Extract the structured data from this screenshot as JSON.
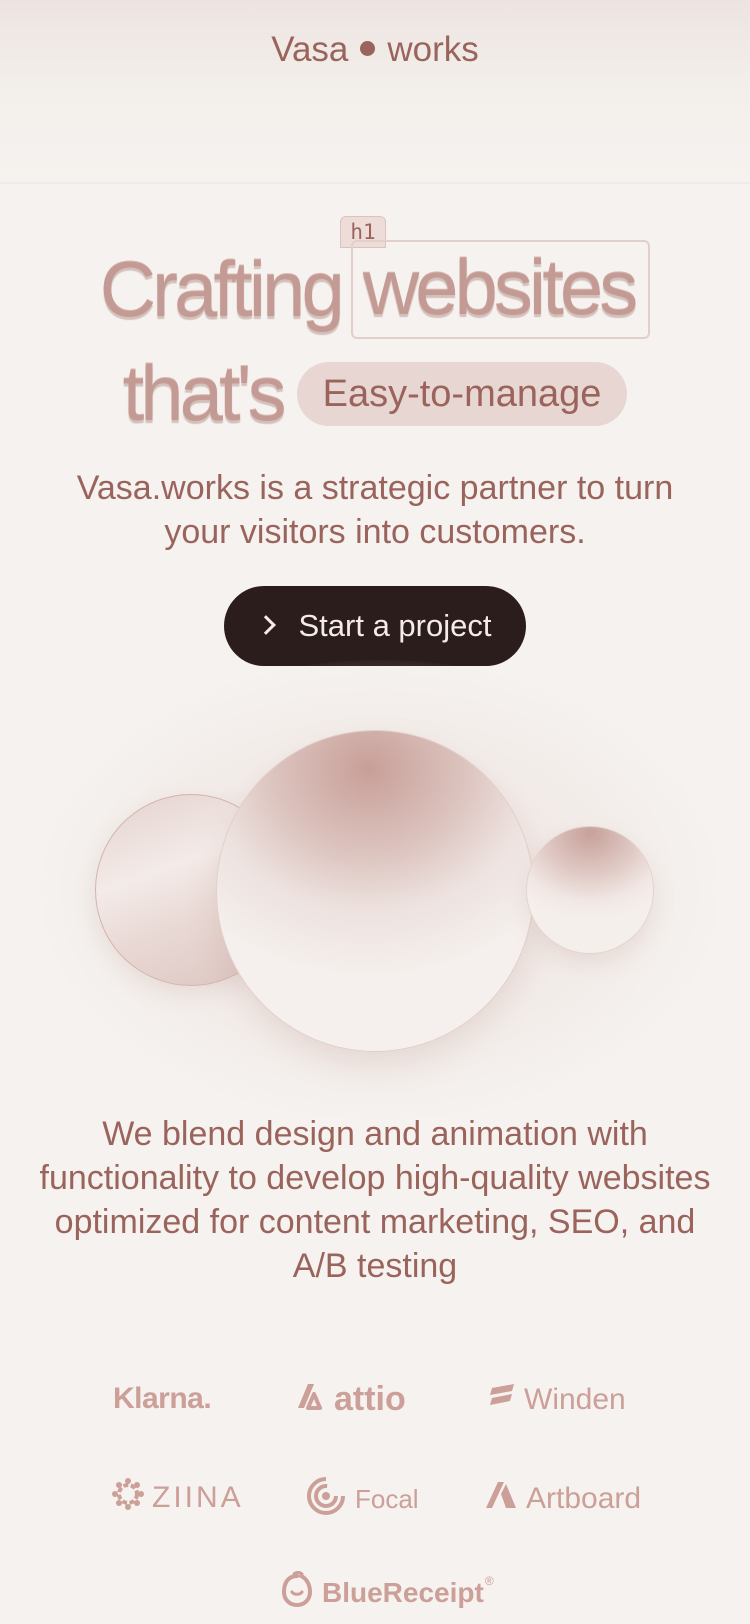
{
  "header": {
    "logo_left": "Vasa",
    "logo_right": "works"
  },
  "hero": {
    "h1_tag": "h1",
    "word_crafting": "Crafting",
    "word_websites": "websites",
    "word_thats": "that's",
    "pill": "Easy-to-manage",
    "subheading": "Vasa.works is a strategic partner to turn your visitors into customers.",
    "cta_label": "Start a project"
  },
  "about": {
    "blurb": "We blend design and animation with functionality to develop high-quality websites optimized for content marketing, SEO, and A/B testing"
  },
  "clients": [
    {
      "name": "Klarna.",
      "icon": "klarna-wordmark"
    },
    {
      "name": "attio",
      "icon": "attio-icon"
    },
    {
      "name": "Winden",
      "icon": "winden-icon"
    },
    {
      "name": "ZIINA",
      "icon": "ziina-icon"
    },
    {
      "name": "Focal",
      "icon": "focal-icon"
    },
    {
      "name": "Artboard",
      "icon": "artboard-icon"
    },
    {
      "name": "BlueReceipt",
      "icon": "bluereceipt-icon",
      "mark": "®"
    }
  ],
  "colors": {
    "background": "#f5f2ef",
    "text": "#9a645c",
    "cta_bg": "#2b1d1c",
    "pill_bg": "#e8d6d2",
    "brand_logo": "#cc9f98"
  }
}
